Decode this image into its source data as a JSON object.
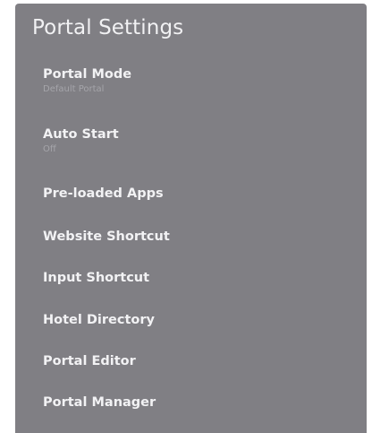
{
  "panel": {
    "title": "Portal Settings",
    "background": "#807f84"
  },
  "menu": {
    "items": [
      {
        "label": "Portal Mode",
        "sublabel": "Default Portal"
      },
      {
        "label": "Auto Start",
        "sublabel": "Off"
      },
      {
        "label": "Pre-loaded Apps"
      },
      {
        "label": "Website Shortcut"
      },
      {
        "label": "Input Shortcut"
      },
      {
        "label": "Hotel Directory"
      },
      {
        "label": "Portal Editor"
      },
      {
        "label": "Portal Manager"
      }
    ]
  }
}
